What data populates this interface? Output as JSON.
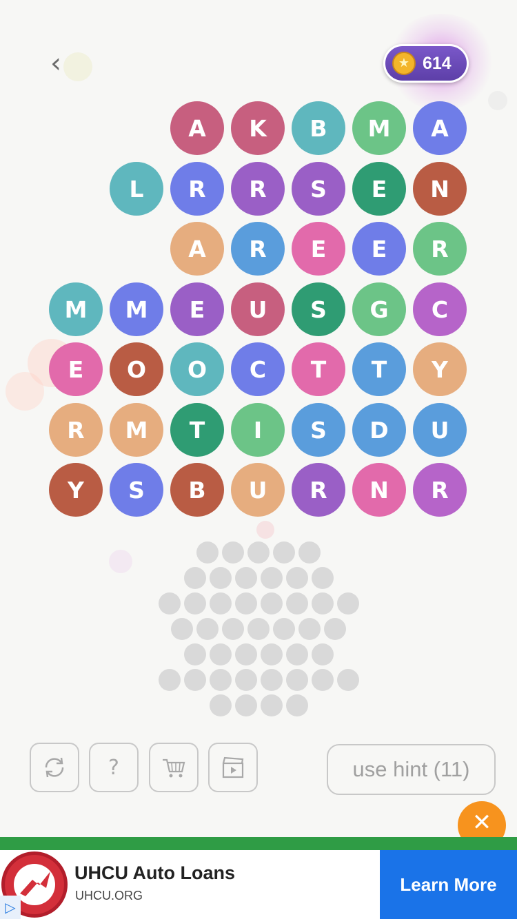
{
  "header": {
    "back_icon": "chevron-left-icon",
    "coin_icon": "star-coin-icon",
    "coins": "614"
  },
  "colors": {
    "rose": "#c75f7f",
    "teal": "#5fb7be",
    "green": "#6cc487",
    "periwinkle": "#6f7de8",
    "purple": "#9a5fc6",
    "rust": "#b95c44",
    "peach": "#e6ad7f",
    "blue": "#5a9ddc",
    "pink": "#e26aab",
    "dkgreen": "#2f9c73",
    "magenta": "#b664c9",
    "hint_badge": "#f7931e",
    "ad_cta": "#1a73e8",
    "ad_bar": "#2f9c45"
  },
  "board": {
    "rows": [
      [
        null,
        null,
        {
          "l": "A",
          "c": "rose"
        },
        {
          "l": "K",
          "c": "rose"
        },
        {
          "l": "B",
          "c": "teal"
        },
        {
          "l": "M",
          "c": "green"
        },
        {
          "l": "A",
          "c": "periwinkle"
        }
      ],
      [
        null,
        {
          "l": "L",
          "c": "teal"
        },
        {
          "l": "R",
          "c": "periwinkle"
        },
        {
          "l": "R",
          "c": "purple"
        },
        {
          "l": "S",
          "c": "purple"
        },
        {
          "l": "E",
          "c": "dkgreen"
        },
        {
          "l": "N",
          "c": "rust"
        }
      ],
      [
        null,
        null,
        {
          "l": "A",
          "c": "peach"
        },
        {
          "l": "R",
          "c": "blue"
        },
        {
          "l": "E",
          "c": "pink"
        },
        {
          "l": "E",
          "c": "periwinkle"
        },
        {
          "l": "R",
          "c": "green"
        }
      ],
      [
        {
          "l": "M",
          "c": "teal"
        },
        {
          "l": "M",
          "c": "periwinkle"
        },
        {
          "l": "E",
          "c": "purple"
        },
        {
          "l": "U",
          "c": "rose"
        },
        {
          "l": "S",
          "c": "dkgreen"
        },
        {
          "l": "G",
          "c": "green"
        },
        {
          "l": "C",
          "c": "magenta"
        }
      ],
      [
        {
          "l": "E",
          "c": "pink"
        },
        {
          "l": "O",
          "c": "rust"
        },
        {
          "l": "O",
          "c": "teal"
        },
        {
          "l": "C",
          "c": "periwinkle"
        },
        {
          "l": "T",
          "c": "pink"
        },
        {
          "l": "T",
          "c": "blue"
        },
        {
          "l": "Y",
          "c": "peach"
        }
      ],
      [
        {
          "l": "R",
          "c": "peach"
        },
        {
          "l": "M",
          "c": "peach"
        },
        {
          "l": "T",
          "c": "dkgreen"
        },
        {
          "l": "I",
          "c": "green"
        },
        {
          "l": "S",
          "c": "blue"
        },
        {
          "l": "D",
          "c": "blue"
        },
        {
          "l": "U",
          "c": "blue"
        }
      ],
      [
        {
          "l": "Y",
          "c": "rust"
        },
        {
          "l": "S",
          "c": "periwinkle"
        },
        {
          "l": "B",
          "c": "rust"
        },
        {
          "l": "U",
          "c": "peach"
        },
        {
          "l": "R",
          "c": "purple"
        },
        {
          "l": "N",
          "c": "pink"
        },
        {
          "l": "R",
          "c": "magenta"
        }
      ]
    ]
  },
  "answer_slots": {
    "rows": [
      5,
      6,
      8,
      7,
      6,
      8,
      4
    ]
  },
  "toolbar": {
    "shuffle_icon": "shuffle-icon",
    "help_icon": "question-icon",
    "help_label": "?",
    "shop_icon": "cart-icon",
    "video_icon": "video-clapper-icon",
    "hint_label": "use hint (11)"
  },
  "ad": {
    "close_label": "✕",
    "title": "UHCU Auto Loans",
    "url": "UHCU.ORG",
    "cta": "Learn More",
    "choices_icon": "ad-choices-icon"
  }
}
